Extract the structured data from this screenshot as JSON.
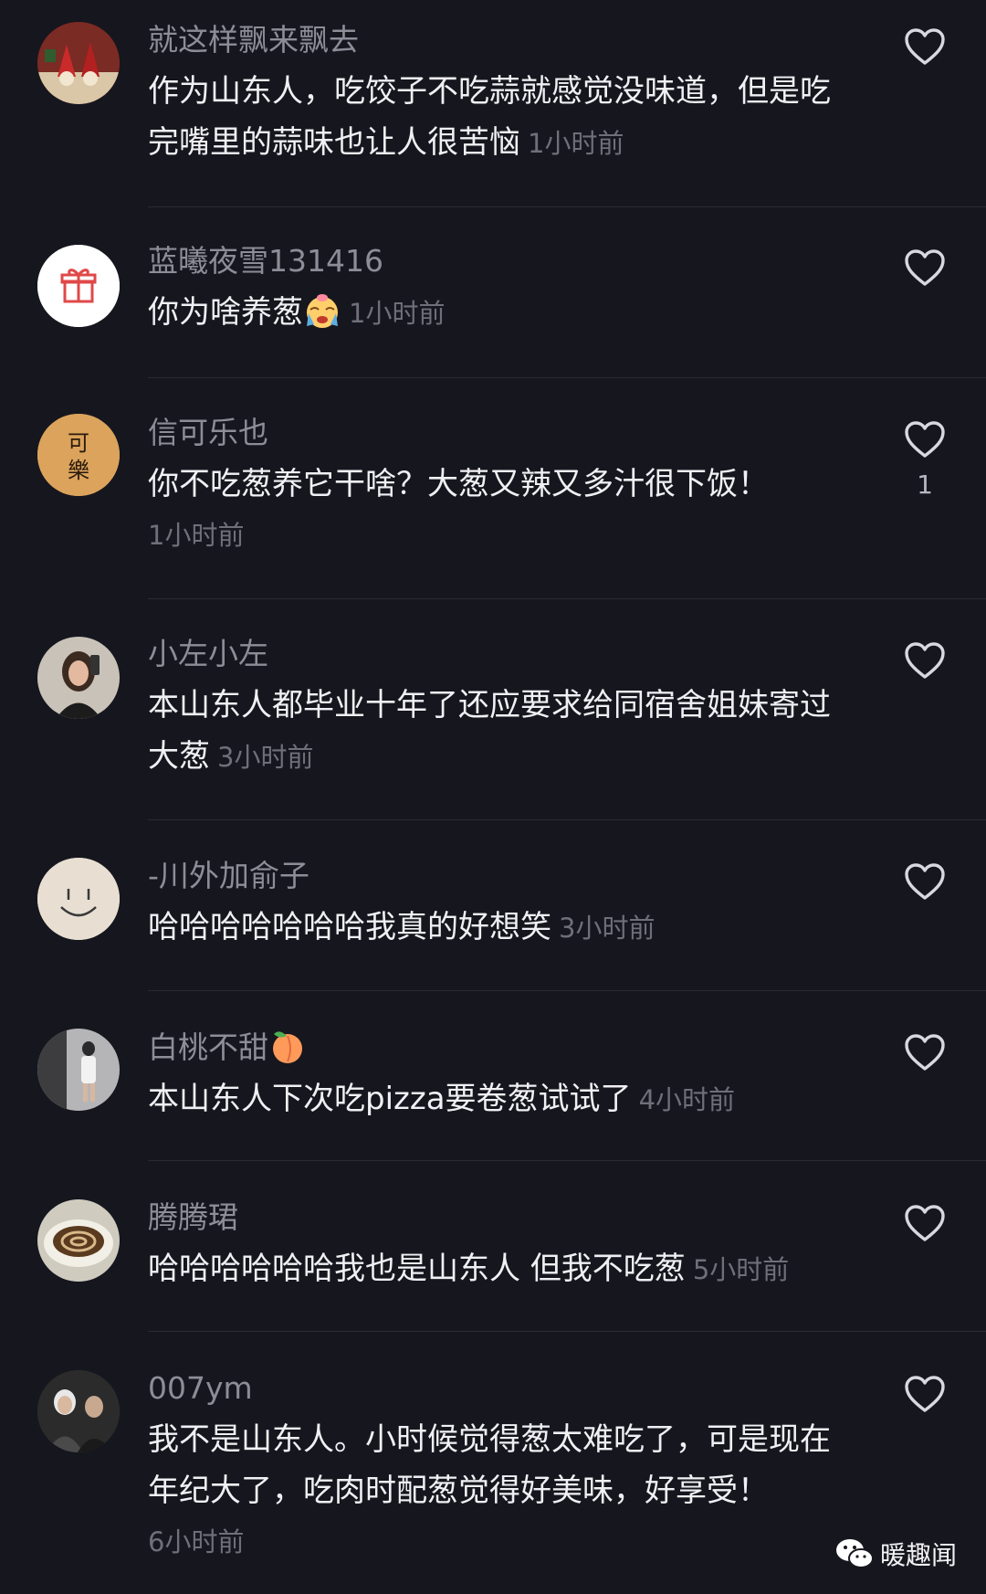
{
  "comments": [
    {
      "username": "就这样飘来飘去",
      "text": "作为山东人，吃饺子不吃蒜就感觉没味道，但是吃完嘴里的蒜味也让人很苦恼",
      "time": "1小时前",
      "avatar": "christmas-gnome-avatar"
    },
    {
      "username": "蓝曦夜雪131416",
      "text": "你为啥养葱",
      "time": "1小时前",
      "avatar": "gift-box-avatar",
      "emoji": "crying-face-emoji"
    },
    {
      "username": "信可乐也",
      "text": "你不吃葱养它干啥？大葱又辣又多汁很下饭！",
      "time": "1小时前",
      "likes": "1",
      "avatar": "calligraphy-avatar",
      "avatar_text": "可樂"
    },
    {
      "username": "小左小左",
      "text": "本山东人都毕业十年了还应要求给同宿舍姐妹寄过大葱",
      "time": "3小时前",
      "avatar": "selfie-photo-avatar"
    },
    {
      "username": "-川外加俞子",
      "text": "哈哈哈哈哈哈哈我真的好想笑",
      "time": "3小时前",
      "avatar": "smiley-face-avatar"
    },
    {
      "username": "白桃不甜",
      "text": "本山东人下次吃pizza要卷葱试试了",
      "time": "4小时前",
      "avatar": "mirror-photo-avatar",
      "username_emoji": "peach-emoji"
    },
    {
      "username": "腾腾珺",
      "text": "哈哈哈哈哈哈我也是山东人 但我不吃葱",
      "time": "5小时前",
      "avatar": "coffee-cup-avatar"
    },
    {
      "username": "007ym",
      "text": "我不是山东人。小时候觉得葱太难吃了，可是现在年纪大了，吃肉时配葱觉得好美味，好享受！",
      "time": "6小时前",
      "avatar": "group-photo-avatar"
    }
  ],
  "watermark": {
    "text": "暖趣闻",
    "icon": "wechat-icon"
  },
  "colors": {
    "background": "#16161e",
    "username": "#8d8d98",
    "time": "#6f6f7a",
    "text": "#f0f0f4"
  }
}
